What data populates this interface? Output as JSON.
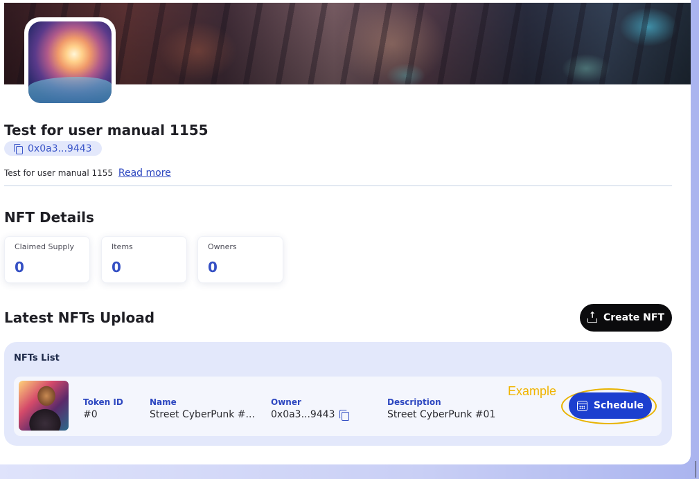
{
  "collection": {
    "title": "Test for user manual 1155",
    "address": "0x0a3...9443",
    "description": "Test for user manual 1155",
    "read_more": "Read more"
  },
  "nft_details": {
    "heading": "NFT Details",
    "stats": [
      {
        "label": "Claimed Supply",
        "value": "0"
      },
      {
        "label": "Items",
        "value": "0"
      },
      {
        "label": "Owners",
        "value": "0"
      }
    ]
  },
  "latest_uploads": {
    "heading": "Latest NFTs Upload",
    "create_button": "Create NFT",
    "list_title": "NFTs List",
    "row": {
      "token_id_label": "Token ID",
      "token_id": "#0",
      "name_label": "Name",
      "name": "Street CyberPunk #...",
      "owner_label": "Owner",
      "owner": "0x0a3...9443",
      "description_label": "Description",
      "description": "Street CyberPunk #01",
      "schedule_button": "Schedule"
    }
  },
  "annotation": {
    "label": "Example",
    "color": "#f0b400"
  },
  "colors": {
    "accent": "#3550c4",
    "button_dark": "#0b0b0d",
    "button_blue": "#1c3fcf"
  },
  "icons": [
    "copy-icon",
    "upload-icon",
    "calendar-icon"
  ]
}
